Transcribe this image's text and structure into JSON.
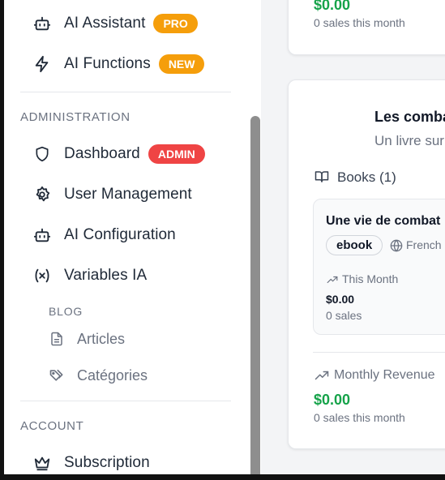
{
  "sidebar": {
    "items_top": [
      {
        "label": "AI Assistant",
        "badge": "PRO",
        "icon": "robot-icon"
      },
      {
        "label": "AI Functions",
        "badge": "NEW",
        "icon": "lightning-icon"
      }
    ],
    "admin_title": "ADMINISTRATION",
    "admin_items": [
      {
        "label": "Dashboard",
        "badge": "ADMIN",
        "icon": "shield-icon"
      },
      {
        "label": "User Management",
        "icon": "gear-icon"
      },
      {
        "label": "AI Configuration",
        "icon": "robot-icon"
      },
      {
        "label": "Variables IA",
        "icon": "variable-icon"
      }
    ],
    "blog_title": "BLOG",
    "blog_items": [
      {
        "label": "Articles",
        "icon": "document-icon"
      },
      {
        "label": "Catégories",
        "icon": "tags-icon"
      }
    ],
    "account_title": "ACCOUNT",
    "account_items": [
      {
        "label": "Subscription",
        "icon": "crown-icon"
      }
    ]
  },
  "main": {
    "top_card": {
      "revenue": "$0.00",
      "sales": "0 sales this month"
    },
    "series_card": {
      "title": "Les comba",
      "subtitle": "Un livre sur",
      "books_header": "Books (1)",
      "book": {
        "title": "Une vie de combat",
        "format": "ebook",
        "language": "French",
        "this_month_label": "This Month",
        "revenue": "$0.00",
        "sales": "0 sales"
      },
      "monthly_label": "Monthly Revenue",
      "monthly_revenue": "$0.00",
      "monthly_sales": "0 sales this month"
    }
  },
  "colors": {
    "accent_orange": "#f59e0b",
    "accent_red": "#ef4444",
    "revenue_green": "#16a34a"
  }
}
